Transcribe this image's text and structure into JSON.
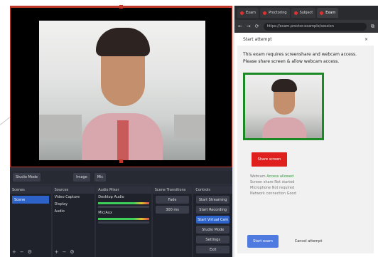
{
  "obs": {
    "toolbar": [
      "Studio Mode",
      "Image",
      "Mic"
    ],
    "docks": {
      "scenes": {
        "title": "Scenes",
        "items": [
          "Scene"
        ]
      },
      "sources": {
        "title": "Sources",
        "items": [
          "Video Capture",
          "Display",
          "Audio"
        ]
      },
      "mixer": {
        "title": "Audio Mixer",
        "tracks": [
          {
            "name": "Desktop Audio",
            "level": "0.0 dB"
          },
          {
            "name": "Mic/Aux",
            "level": "0.0 dB"
          }
        ]
      },
      "transitions": {
        "title": "Scene Transitions",
        "type": "Fade",
        "duration": "300 ms"
      },
      "controls": {
        "title": "Controls",
        "buttons": [
          "Start Streaming",
          "Start Recording",
          "Start Virtual Cam",
          "Studio Mode",
          "Settings",
          "Exit"
        ]
      }
    }
  },
  "browser": {
    "tabs": [
      "Exam",
      "Proctoring",
      "Subject",
      "Exam"
    ],
    "url": "https://exam.proctor.example/session"
  },
  "panel": {
    "title": "Start attempt",
    "close": "×",
    "instruction_1": "This exam requires screenshare and webcam access.",
    "instruction_2": "Please share screen & allow webcam access.",
    "share_button": "Share screen",
    "status_lines": [
      {
        "label": "Webcam",
        "value": "Access allowed"
      },
      {
        "label": "Screen share",
        "value": "Not started"
      },
      {
        "label": "Microphone",
        "value": "Not required"
      },
      {
        "label": "Network connection",
        "value": "Good"
      }
    ],
    "start_button": "Start exam",
    "cancel_button": "Cancel attempt"
  },
  "colors": {
    "accent": "#2d63c8",
    "record": "#c0392b",
    "ok": "#1c8a24",
    "share": "#e0201c"
  }
}
